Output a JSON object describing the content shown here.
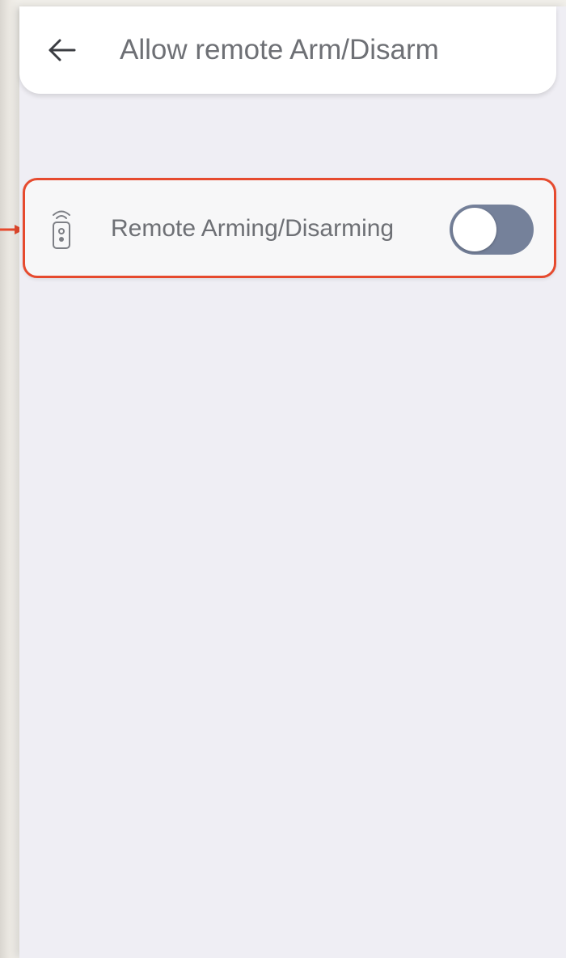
{
  "header": {
    "title": "Allow remote Arm/Disarm",
    "back_icon": "arrow-left-icon"
  },
  "setting": {
    "icon": "remote-control-icon",
    "label": "Remote Arming/Disarming",
    "toggle_on": false
  },
  "colors": {
    "highlight": "#e64a2e",
    "toggle_track": "#75819a",
    "background": "#efeef4",
    "text": "#6e7075"
  }
}
